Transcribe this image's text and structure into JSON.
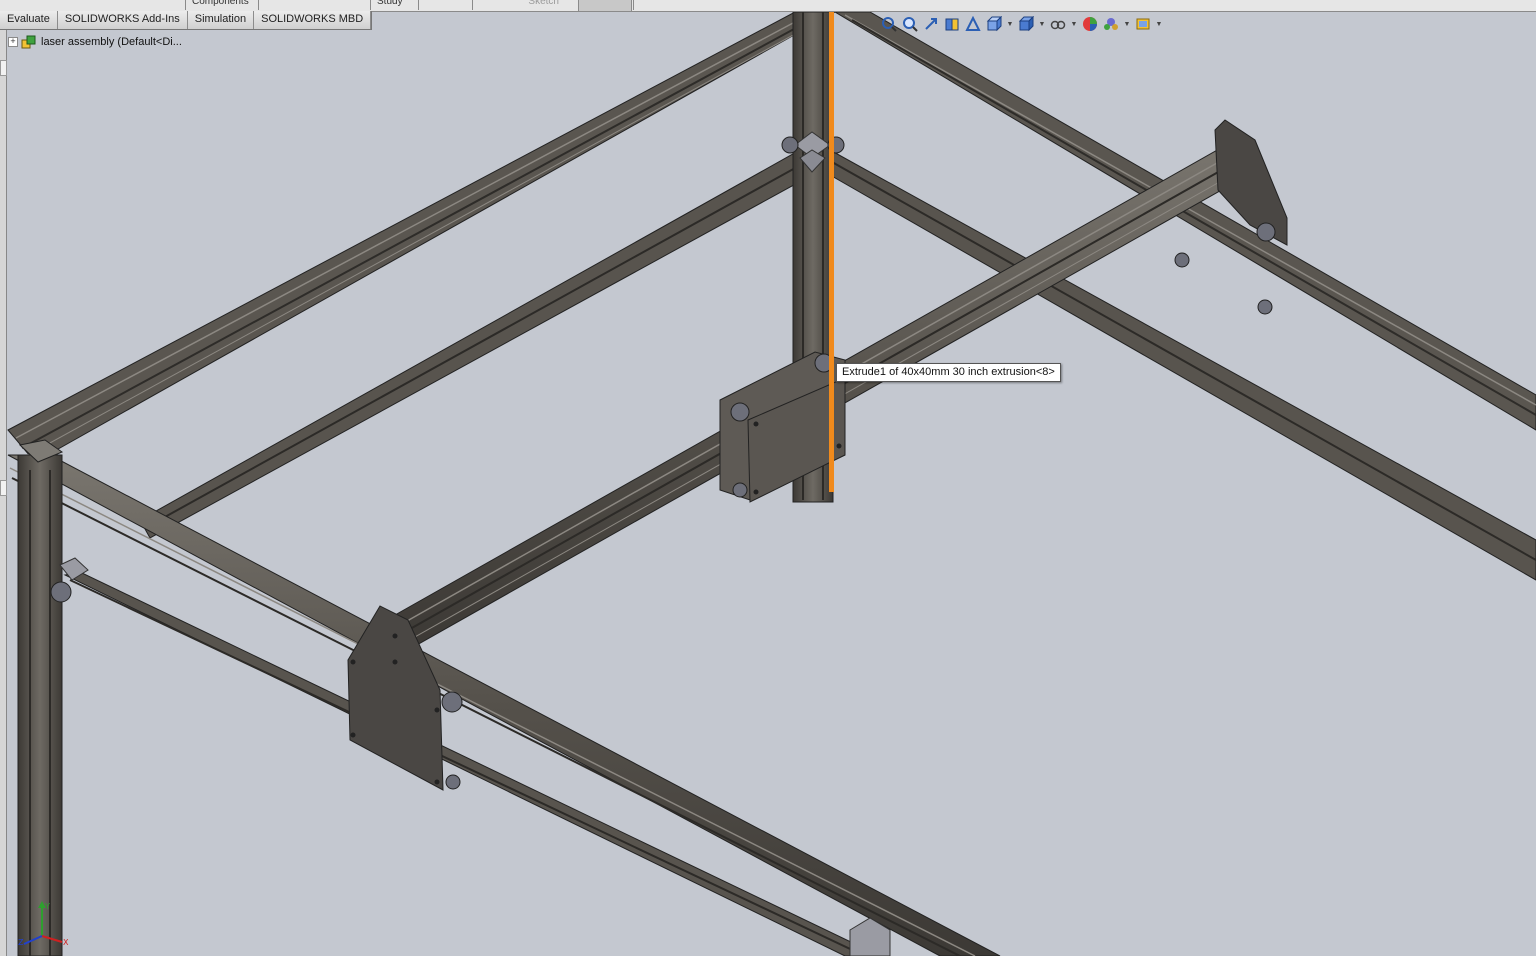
{
  "topstrip": {
    "items": [
      "Components",
      "Study",
      "Sketch"
    ]
  },
  "tabs": [
    {
      "label": "Evaluate"
    },
    {
      "label": "SOLIDWORKS Add-Ins"
    },
    {
      "label": "Simulation"
    },
    {
      "label": "SOLIDWORKS MBD"
    }
  ],
  "tree": {
    "root_label": "laser assembly  (Default<Di..."
  },
  "tooltip": {
    "text": "Extrude1 of 40x40mm 30 inch extrusion<8>"
  },
  "triad": {
    "y": "Y",
    "z": "Z",
    "x": "X"
  },
  "view_toolbar": {
    "icons": [
      "zoom-to-fit-icon",
      "zoom-to-area-icon",
      "previous-view-icon",
      "section-view-icon",
      "dynamic-annotation-icon",
      "view-orientation-icon",
      "display-style-icon",
      "hide-show-icon",
      "edit-appearance-icon",
      "apply-scene-icon",
      "view-settings-icon"
    ]
  },
  "colors": {
    "background": "#c4c8d0",
    "extrusion": "#5a5650",
    "highlight": "#f08a1c"
  }
}
